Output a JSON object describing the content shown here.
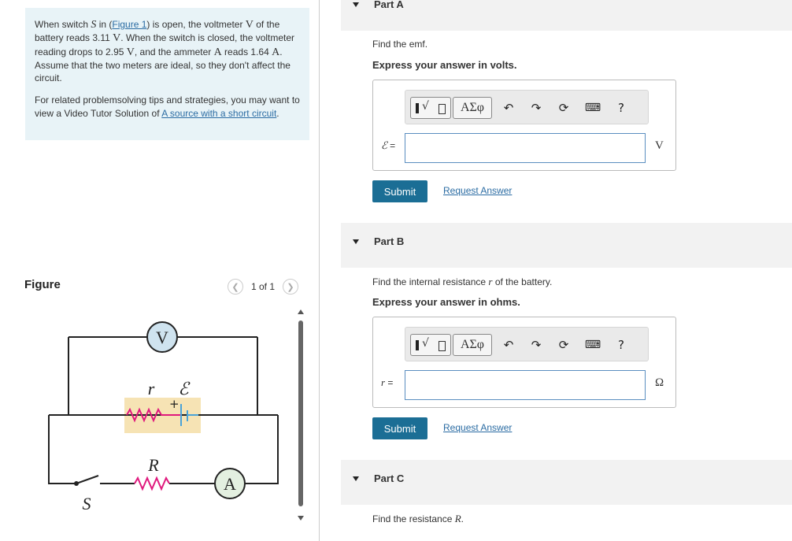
{
  "problem": {
    "p1": {
      "t1": "When switch ",
      "switch_sym": "S",
      "t2": " in (",
      "figure_link": "Figure 1",
      "t3": ") is open, the voltmeter ",
      "voltmeter_sym": "V",
      "t4": " of the battery reads 3.11 ",
      "unit_v1": "V",
      "t5": ". When the switch is closed, the voltmeter reading drops to 2.95 ",
      "unit_v2": "V",
      "t6": ", and the ammeter ",
      "ammeter_sym": "A",
      "t7": " reads 1.64 ",
      "unit_a": "A",
      "t8": ". Assume that the two meters are ideal, so they don't affect the circuit."
    },
    "p2": {
      "text": "For related problemsolving tips and strategies, you may want to view a Video Tutor Solution of ",
      "link": "A source with a short circuit",
      "end": "."
    }
  },
  "figure": {
    "title": "Figure",
    "pager_text": "1 of 1",
    "prev_icon": "chevron-left-icon",
    "next_icon": "chevron-right-icon",
    "labels": {
      "voltmeter": "V",
      "r": "r",
      "emf": "ℰ",
      "plus": "+",
      "R": "R",
      "ammeter": "A",
      "switch": "S"
    },
    "colors": {
      "resistor": "#e0197d",
      "battery_bg": "#f6e3b4",
      "battery_plate": "#4aa3d8",
      "meter_fill": "#cfe3ef",
      "ammeter_fill": "#e3efe0"
    }
  },
  "parts": [
    {
      "label": "Part A",
      "question": "Find the emf.",
      "instruction": "Express your answer in volts.",
      "var": "ℰ",
      "eq": "=",
      "value": "",
      "unit": "V",
      "submit": "Submit",
      "request": "Request Answer"
    },
    {
      "label": "Part B",
      "question_pre": "Find the internal resistance ",
      "question_var": "r",
      "question_post": " of the battery.",
      "instruction": "Express your answer in ohms.",
      "var": "r",
      "eq": "=",
      "value": "",
      "unit": "Ω",
      "submit": "Submit",
      "request": "Request Answer"
    },
    {
      "label": "Part C",
      "question_pre": "Find the resistance ",
      "question_var": "R",
      "question_post": "."
    }
  ],
  "toolbar": {
    "template_icon": "template-icon",
    "symbols_label": "ΑΣφ",
    "undo_icon": "undo-icon",
    "redo_icon": "redo-icon",
    "reset_icon": "reset-icon",
    "keyboard_icon": "keyboard-icon",
    "help_label": "?"
  }
}
